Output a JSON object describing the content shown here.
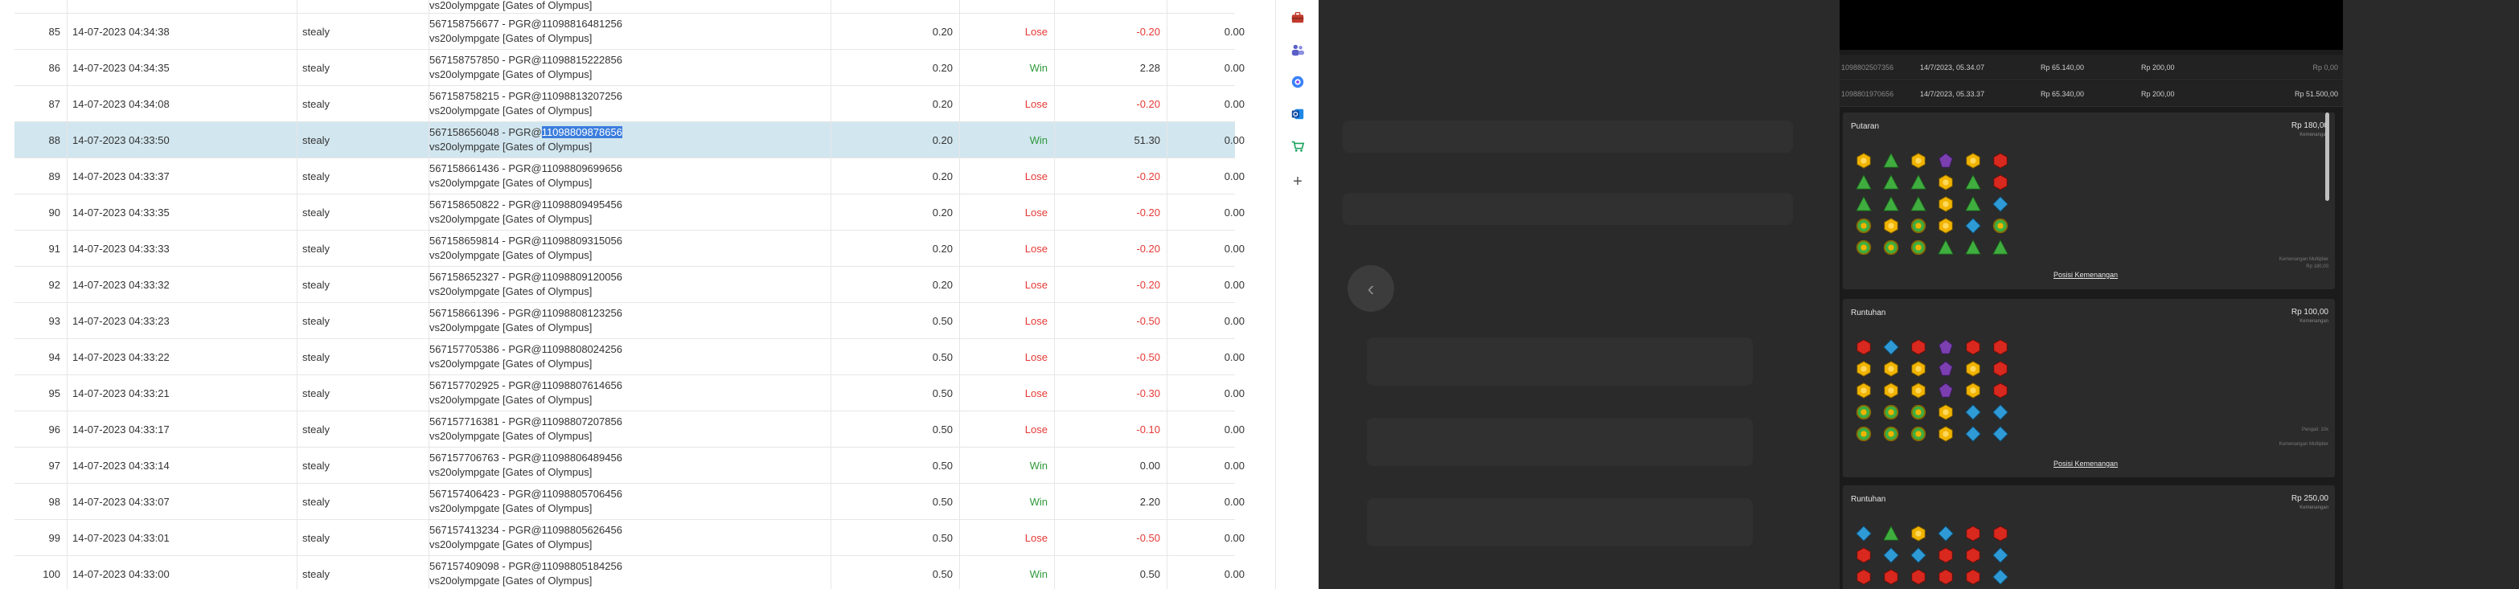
{
  "bet_table": {
    "top_partial": {
      "trx_line2": "vs20olympgate [Gates of Olympus]"
    },
    "rows": [
      {
        "no": "85",
        "date": "14-07-2023 04:34:38",
        "user": "stealy",
        "trx": "567158756677 - PGR@110988164 81256",
        "trx_a": "567158756677 - PGR@110988164",
        "trx_b": "81256",
        "game": "vs20olympgate [Gates of Olympus]",
        "bet": "0.20",
        "result": "Lose",
        "win": "-0.20",
        "jp": "0.00"
      },
      {
        "no": "86",
        "date": "14-07-2023 04:34:35",
        "user": "stealy",
        "trx_a": "567158757850 - PGR@110988152",
        "trx_b": "22856",
        "game": "vs20olympgate [Gates of Olympus]",
        "bet": "0.20",
        "result": "Win",
        "win": "2.28",
        "jp": "0.00"
      },
      {
        "no": "87",
        "date": "14-07-2023 04:34:08",
        "user": "stealy",
        "trx_a": "567158758215 - PGR@110988132",
        "trx_b": "07256",
        "game": "vs20olympgate [Gates of Olympus]",
        "bet": "0.20",
        "result": "Lose",
        "win": "-0.20",
        "jp": "0.00"
      },
      {
        "no": "88",
        "date": "14-07-2023 04:33:50",
        "user": "stealy",
        "trx_a": "567158656048 - PGR@",
        "trx_b": "11098809878656",
        "game": "vs20olympgate [Gates of Olympus]",
        "bet": "0.20",
        "result": "Win",
        "win": "51.30",
        "jp": "0.00",
        "selected": true
      },
      {
        "no": "89",
        "date": "14-07-2023 04:33:37",
        "user": "stealy",
        "trx_a": "567158661436 - PGR@110988096",
        "trx_b": "99656",
        "game": "vs20olympgate [Gates of Olympus]",
        "bet": "0.20",
        "result": "Lose",
        "win": "-0.20",
        "jp": "0.00"
      },
      {
        "no": "90",
        "date": "14-07-2023 04:33:35",
        "user": "stealy",
        "trx_a": "567158650822 - PGR@110988094",
        "trx_b": "95456",
        "game": "vs20olympgate [Gates of Olympus]",
        "bet": "0.20",
        "result": "Lose",
        "win": "-0.20",
        "jp": "0.00"
      },
      {
        "no": "91",
        "date": "14-07-2023 04:33:33",
        "user": "stealy",
        "trx_a": "567158659814 - PGR@110988093",
        "trx_b": "15056",
        "game": "vs20olympgate [Gates of Olympus]",
        "bet": "0.20",
        "result": "Lose",
        "win": "-0.20",
        "jp": "0.00"
      },
      {
        "no": "92",
        "date": "14-07-2023 04:33:32",
        "user": "stealy",
        "trx_a": "567158652327 - PGR@110988091",
        "trx_b": "20056",
        "game": "vs20olympgate [Gates of Olympus]",
        "bet": "0.20",
        "result": "Lose",
        "win": "-0.20",
        "jp": "0.00"
      },
      {
        "no": "93",
        "date": "14-07-2023 04:33:23",
        "user": "stealy",
        "trx_a": "567158661396 - PGR@110988081",
        "trx_b": "23256",
        "game": "vs20olympgate [Gates of Olympus]",
        "bet": "0.50",
        "result": "Lose",
        "win": "-0.50",
        "jp": "0.00"
      },
      {
        "no": "94",
        "date": "14-07-2023 04:33:22",
        "user": "stealy",
        "trx_a": "567157705386 - PGR@110988080",
        "trx_b": "24256",
        "game": "vs20olympgate [Gates of Olympus]",
        "bet": "0.50",
        "result": "Lose",
        "win": "-0.50",
        "jp": "0.00"
      },
      {
        "no": "95",
        "date": "14-07-2023 04:33:21",
        "user": "stealy",
        "trx_a": "567157702925 - PGR@110988076",
        "trx_b": "14656",
        "game": "vs20olympgate [Gates of Olympus]",
        "bet": "0.50",
        "result": "Lose",
        "win": "-0.30",
        "jp": "0.00"
      },
      {
        "no": "96",
        "date": "14-07-2023 04:33:17",
        "user": "stealy",
        "trx_a": "567157716381 - PGR@110988072",
        "trx_b": "07856",
        "game": "vs20olympgate [Gates of Olympus]",
        "bet": "0.50",
        "result": "Lose",
        "win": "-0.10",
        "jp": "0.00"
      },
      {
        "no": "97",
        "date": "14-07-2023 04:33:14",
        "user": "stealy",
        "trx_a": "567157706763 - PGR@110988064",
        "trx_b": "89456",
        "game": "vs20olympgate [Gates of Olympus]",
        "bet": "0.50",
        "result": "Win",
        "win": "0.00",
        "jp": "0.00"
      },
      {
        "no": "98",
        "date": "14-07-2023 04:33:07",
        "user": "stealy",
        "trx_a": "567157406423 - PGR@110988057",
        "trx_b": "06456",
        "game": "vs20olympgate [Gates of Olympus]",
        "bet": "0.50",
        "result": "Win",
        "win": "2.20",
        "jp": "0.00"
      },
      {
        "no": "99",
        "date": "14-07-2023 04:33:01",
        "user": "stealy",
        "trx_a": "567157413234 - PGR@110988056",
        "trx_b": "26456",
        "game": "vs20olympgate [Gates of Olympus]",
        "bet": "0.50",
        "result": "Lose",
        "win": "-0.50",
        "jp": "0.00"
      },
      {
        "no": "100",
        "date": "14-07-2023 04:33:00",
        "user": "stealy",
        "trx_a": "567157409098 - PGR@110988051",
        "trx_b": "84256",
        "game": "vs20olympgate [Gates of Olympus]",
        "bet": "0.50",
        "result": "Win",
        "win": "0.50",
        "jp": "0.00"
      }
    ]
  },
  "sidebar": {
    "icons": [
      "toolbox-icon",
      "people-icon",
      "edge-circle-icon",
      "outlook-icon",
      "cart-icon",
      "add-icon"
    ]
  },
  "mobile": {
    "history": [
      {
        "id": "1098802507356",
        "date": "14/7/2023, 05.34.07",
        "balance": "Rp 65.140,00",
        "bet": "Rp 200,00",
        "win": "Rp 0,00"
      },
      {
        "id": "1098801970656",
        "date": "14/7/2023, 05.33.37",
        "balance": "Rp 65.340,00",
        "bet": "Rp 200,00",
        "win": "Rp 51.500,00"
      }
    ],
    "cards": [
      {
        "title": "Putaran",
        "amount": "Rp 180,00",
        "sub": "Kemenangan",
        "link": "Posisi Kemenangan",
        "note1": "Kemenangan Multiplier",
        "note2": "Rp 180,00"
      },
      {
        "title": "Runtuhan",
        "amount": "Rp 100,00",
        "sub": "Kemenangan",
        "link": "Posisi Kemenangan",
        "note1": "Pengali: 10x",
        "note2": "Kemenangan Multiplier"
      },
      {
        "title": "Runtuhan",
        "amount": "Rp 250,00",
        "sub": "Kemenangan"
      }
    ],
    "colors": {
      "gem_yellow": "#f0b400",
      "gem_green": "#3fae3f",
      "gem_purple": "#7b3fb0",
      "gem_red": "#d9281e",
      "gem_blue": "#2e9ad6"
    }
  }
}
